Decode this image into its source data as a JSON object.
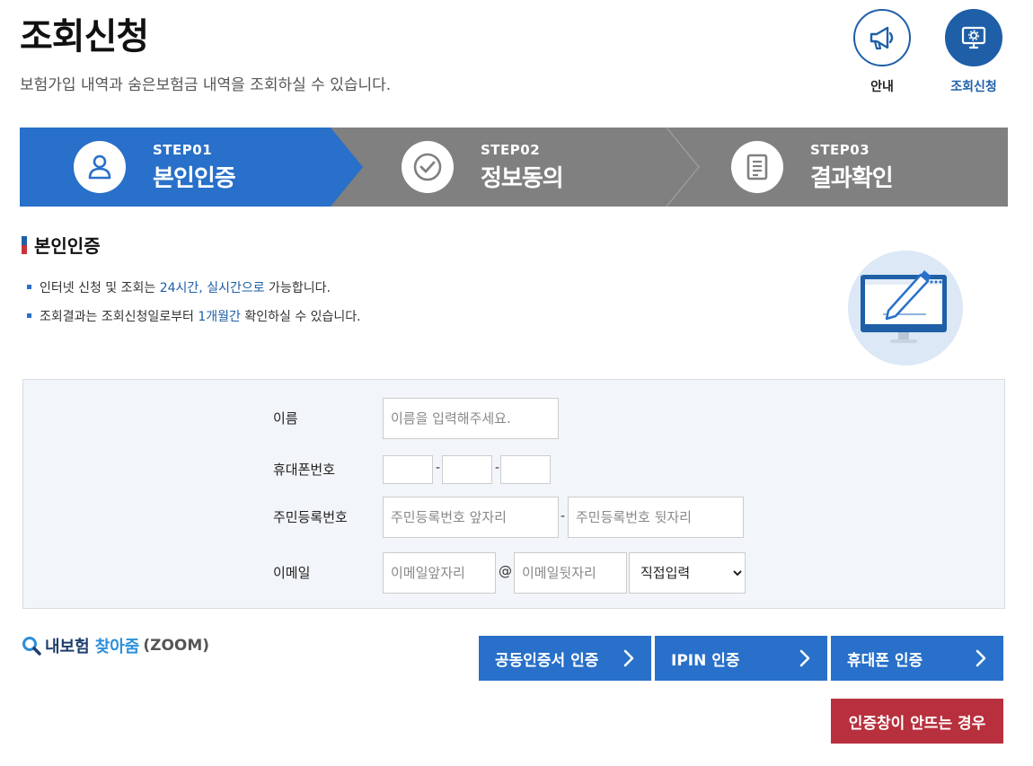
{
  "header": {
    "title": "조회신청",
    "description": "보험가입 내역과 숨은보험금 내역을 조회하실 수 있습니다.",
    "guide_label": "안내",
    "inquiry_label": "조회신청"
  },
  "steps": [
    {
      "num": "STEP01",
      "name": "본인인증",
      "icon": "person-icon",
      "active": true
    },
    {
      "num": "STEP02",
      "name": "정보동의",
      "icon": "check-circle-icon",
      "active": false
    },
    {
      "num": "STEP03",
      "name": "결과확인",
      "icon": "document-icon",
      "active": false
    }
  ],
  "section": {
    "title": "본인인증",
    "note1_pre": "인터넷 신청 및 조회는 ",
    "note1_hl": "24시간, 실시간으로",
    "note1_post": " 가능합니다.",
    "note2_pre": "조회결과는 조회신청일로부터 ",
    "note2_hl": "1개월간",
    "note2_post": " 확인하실 수 있습니다."
  },
  "form": {
    "name_label": "이름",
    "name_placeholder": "이름을 입력해주세요.",
    "phone_label": "휴대폰번호",
    "phone_sep": "-",
    "rrn_label": "주민등록번호",
    "rrn_front_placeholder": "주민등록번호 앞자리",
    "rrn_back_placeholder": "주민등록번호 뒷자리",
    "rrn_sep": "-",
    "email_label": "이메일",
    "email_front_placeholder": "이메일앞자리",
    "email_at": "@",
    "email_back_placeholder": "이메일뒷자리",
    "email_domain_selected": "직접입력"
  },
  "zoom": {
    "part1": "내보험",
    "part2": "찾아줌",
    "part3": "(ZOOM)"
  },
  "auth": {
    "cert_label": "공동인증서 인증",
    "ipin_label": "IPIN 인증",
    "phone_label": "휴대폰 인증",
    "help_label": "인증창이 안뜨는 경우"
  },
  "colors": {
    "primary": "#2870c9",
    "navy": "#1e5fa8",
    "step_inactive": "#808080",
    "danger": "#b8303d"
  }
}
